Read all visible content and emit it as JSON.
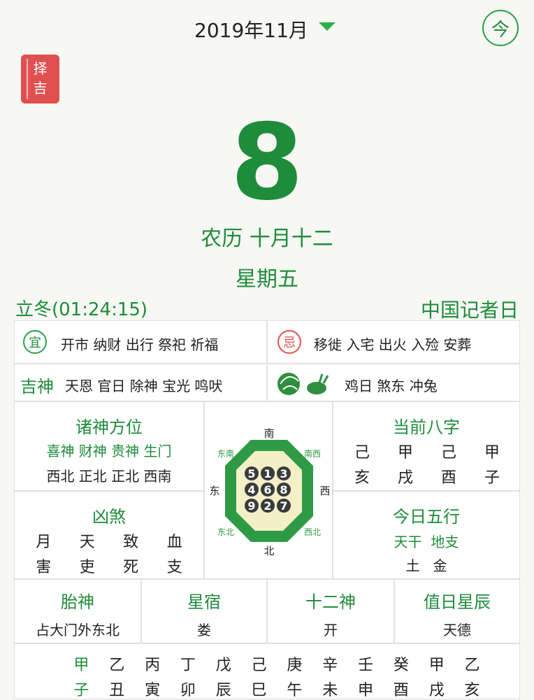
{
  "header": {
    "month_label": "2019年11月",
    "today_label": "今",
    "zeji_label": [
      "择",
      "吉"
    ]
  },
  "date": {
    "day": "8",
    "lunar": "农历 十月十二",
    "weekday": "星期五",
    "solar_term": "立冬(01:24:15)",
    "festival": "中国记者日"
  },
  "yi": {
    "icon": "宜",
    "items": "开市 纳财 出行 祭祀 祈福"
  },
  "ji": {
    "icon": "忌",
    "items": "移徙 入宅 出火 入殓 安葬"
  },
  "jishen": {
    "label": "吉神",
    "items": "天恩 官日 除神 宝光 鸣吠"
  },
  "zodiac": {
    "items": "鸡日 煞东 冲兔"
  },
  "zhushen": {
    "title": "诸神方位",
    "gods": "喜神 财神 贵神 生门",
    "directions": "西北 正北 正北 西南"
  },
  "bazi": {
    "title": "当前八字",
    "row1": [
      "己",
      "甲",
      "己",
      "甲"
    ],
    "row2": [
      "亥",
      "戌",
      "酉",
      "子"
    ]
  },
  "xiongsha": {
    "title": "凶煞",
    "row1": [
      "月",
      "天",
      "致",
      "血"
    ],
    "row2": [
      "害",
      "吏",
      "死",
      "支"
    ]
  },
  "wuxing": {
    "title": "今日五行",
    "labels": "天干  地支",
    "values": "土   金"
  },
  "compass": {
    "directions": {
      "s": "南",
      "n": "北",
      "e": "东",
      "w": "西",
      "se": "东南",
      "sw": "南西",
      "ne": "东北",
      "nw": "西北"
    },
    "numbers": [
      [
        "5",
        "1",
        "3"
      ],
      [
        "4",
        "6",
        "8"
      ],
      [
        "9",
        "2",
        "7"
      ]
    ]
  },
  "bottom": [
    {
      "title": "胎神",
      "value": "占大门外东北"
    },
    {
      "title": "星宿",
      "value": "娄"
    },
    {
      "title": "十二神",
      "value": "开"
    },
    {
      "title": "值日星辰",
      "value": "天德"
    }
  ],
  "ganzhi": {
    "stems": [
      "甲",
      "乙",
      "丙",
      "丁",
      "戊",
      "己",
      "庚",
      "辛",
      "壬",
      "癸",
      "甲",
      "乙"
    ],
    "branches": [
      "子",
      "丑",
      "寅",
      "卯",
      "辰",
      "巳",
      "午",
      "未",
      "申",
      "酉",
      "戌",
      "亥"
    ]
  },
  "colors": {
    "green": "#1e8c3a",
    "red": "#e05050"
  }
}
